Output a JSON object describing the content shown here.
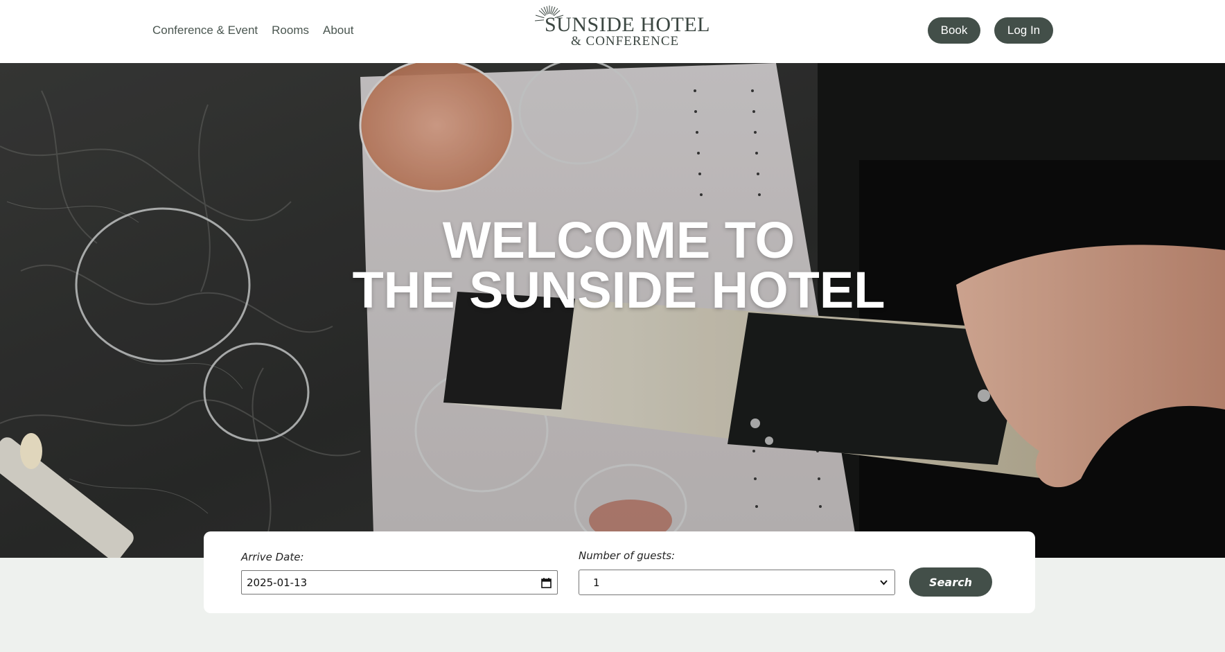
{
  "header": {
    "nav": [
      {
        "label": "Conference & Event"
      },
      {
        "label": "Rooms"
      },
      {
        "label": "About"
      }
    ],
    "logo": {
      "line1": "SUNSIDE HOTEL",
      "line2": "& CONFERENCE"
    },
    "book_label": "Book",
    "login_label": "Log In"
  },
  "hero": {
    "title_line1": "WELCOME TO",
    "title_line2": "THE SUNSIDE HOTEL"
  },
  "search": {
    "arrive_label": "Arrive Date:",
    "arrive_value": "2025-01-13",
    "guests_label": "Number of guests:",
    "guests_value": "1",
    "search_label": "Search"
  },
  "colors": {
    "accent": "#434f49",
    "nav_text": "#4a5650",
    "page_bg_lower": "#eef1ee"
  },
  "icons": [
    "sun-logo-icon",
    "calendar-icon",
    "chevron-down-icon"
  ]
}
